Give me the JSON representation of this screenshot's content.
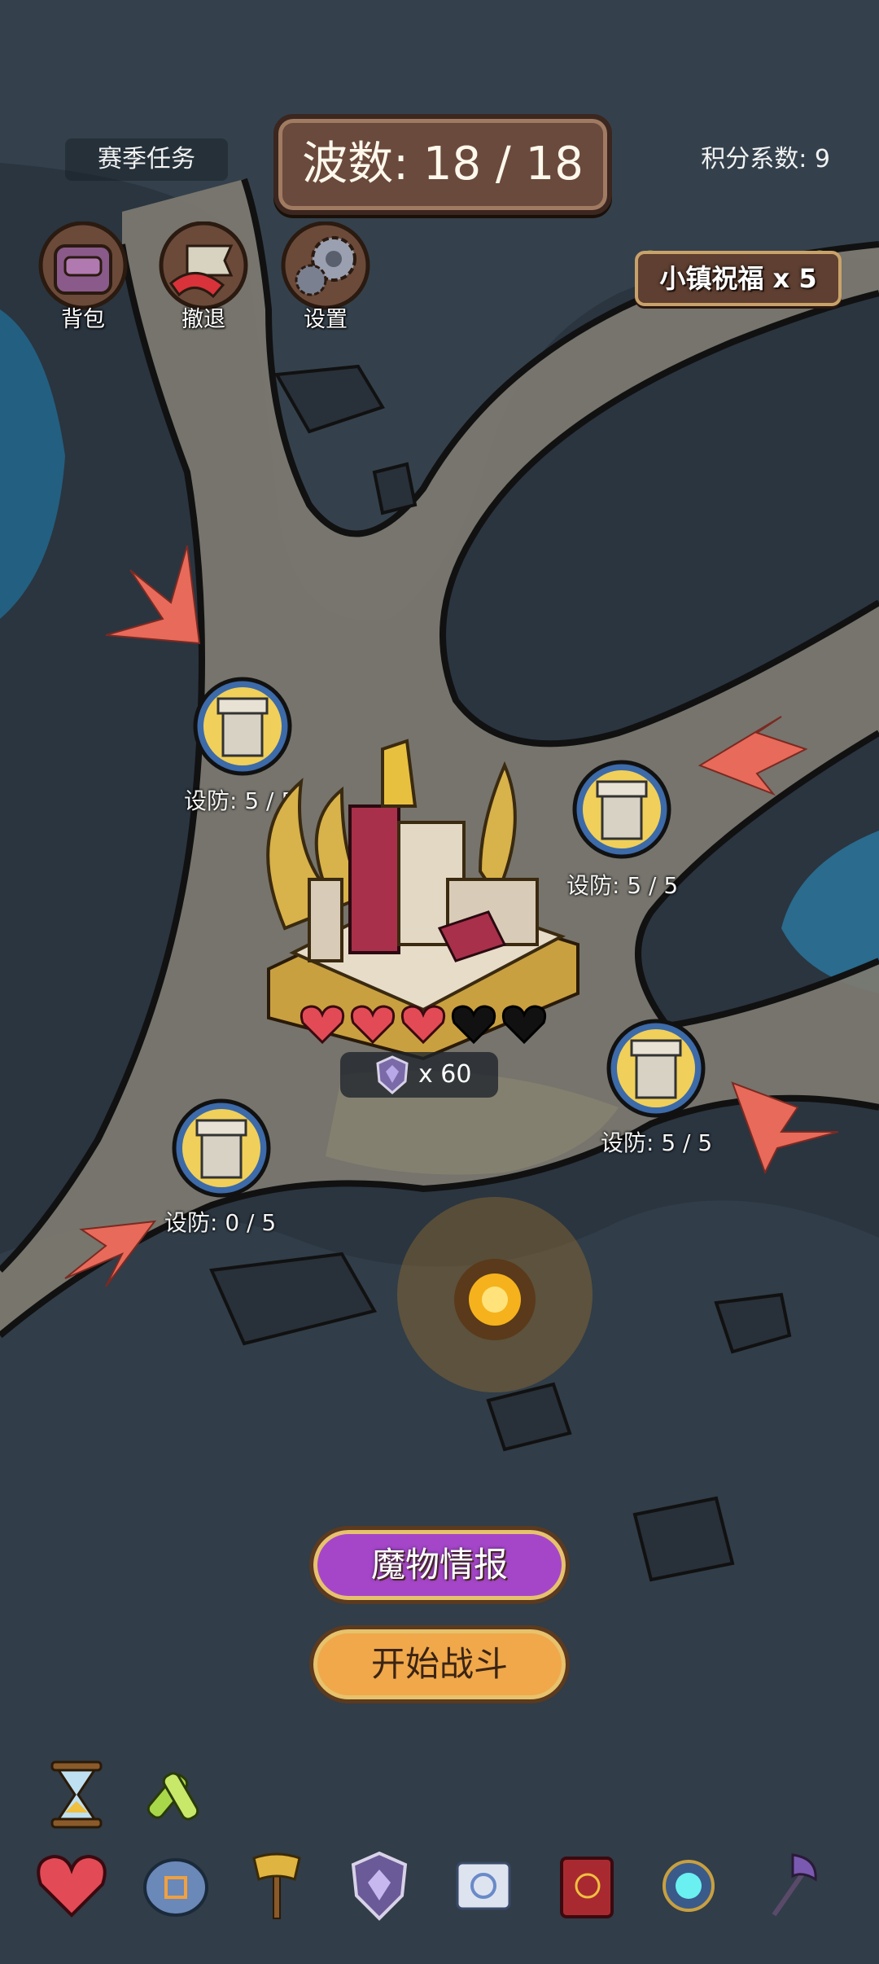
{
  "hud": {
    "season_task": "赛季任务",
    "wave": "波数: 18 / 18",
    "score_coef": "积分系数: 9",
    "blessing": "小镇祝福 x 5"
  },
  "top_buttons": [
    {
      "label": "背包",
      "icon": "backpack-icon"
    },
    {
      "label": "撤退",
      "icon": "retreat-flag-icon"
    },
    {
      "label": "设置",
      "icon": "gears-icon"
    }
  ],
  "towers": [
    {
      "label": "设防: 5 / 5",
      "icon": "tower-icon"
    },
    {
      "label": "设防: 5 / 5",
      "icon": "tower-icon"
    },
    {
      "label": "设防: 5 / 5",
      "icon": "tower-icon"
    },
    {
      "label": "设防: 0 / 5",
      "icon": "tower-icon"
    }
  ],
  "castle": {
    "hearts_full": 3,
    "hearts_total": 5,
    "trophy_count": "x 60"
  },
  "buttons": {
    "monster_info": "魔物情报",
    "start_battle": "开始战斗"
  },
  "tools": [
    "hourglass-icon",
    "potion-vials-icon"
  ],
  "bottom_bar": [
    "heart-icon",
    "rune-stone-icon",
    "golden-axe-icon",
    "shield-emblem-icon",
    "scroll-icon",
    "red-book-icon",
    "crystal-orb-icon",
    "dark-halberd-icon"
  ],
  "colors": {
    "path": "#7d7a70",
    "rock": "#3e4a55",
    "water": "#2a6b8e",
    "arrow": "#e86a5a",
    "monster_btn": "#a546c9",
    "fight_btn": "#f0a84a",
    "heart_full": "#e24b56",
    "heart_empty": "#111111"
  }
}
